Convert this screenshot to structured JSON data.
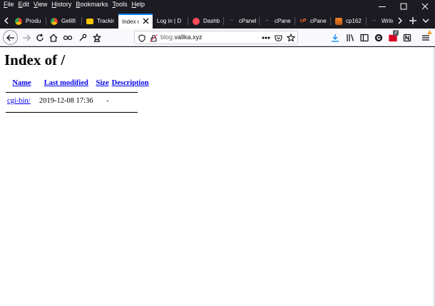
{
  "menu": [
    "File",
    "Edit",
    "View",
    "History",
    "Bookmarks",
    "Tools",
    "Help"
  ],
  "tabs": [
    {
      "label": "Produ",
      "favicon": "chrome-icon",
      "color": "#e44d26"
    },
    {
      "label": "Gellifi",
      "favicon": "chrome-icon",
      "color": "#e44d26"
    },
    {
      "label": "Trackir",
      "favicon": "tracking-icon",
      "color": "#f7c600"
    },
    {
      "label": "Index o",
      "favicon": "none",
      "active": true
    },
    {
      "label": "Log in | D",
      "favicon": "none"
    },
    {
      "label": "Dashb",
      "favicon": "dashboard-icon",
      "color": "#ff4c5b"
    },
    {
      "label": "cPanel",
      "favicon": "cpanel-dots-icon",
      "color": "#5aa0e5"
    },
    {
      "label": "cPane",
      "favicon": "cpanel-dots-icon",
      "color": "#5aa0e5"
    },
    {
      "label": "cPane",
      "favicon": "cpanel-logo-icon",
      "color": "#ff6c2c"
    },
    {
      "label": "cp162",
      "favicon": "stack-icon",
      "color": "#f48024"
    },
    {
      "label": "Write",
      "favicon": "dots-icon",
      "color": "#5aa0e5"
    }
  ],
  "url": {
    "prefix": "blog.",
    "domain": "vallka.xyz"
  },
  "toolbar": {
    "notification_count": "2"
  },
  "page": {
    "title": "Index of /",
    "columns": [
      "Name",
      "Last modified",
      "Size",
      "Description"
    ],
    "rows": [
      {
        "name": "cgi-bin/",
        "modified": "2019-12-08 17:36",
        "size": "-",
        "description": ""
      }
    ]
  }
}
